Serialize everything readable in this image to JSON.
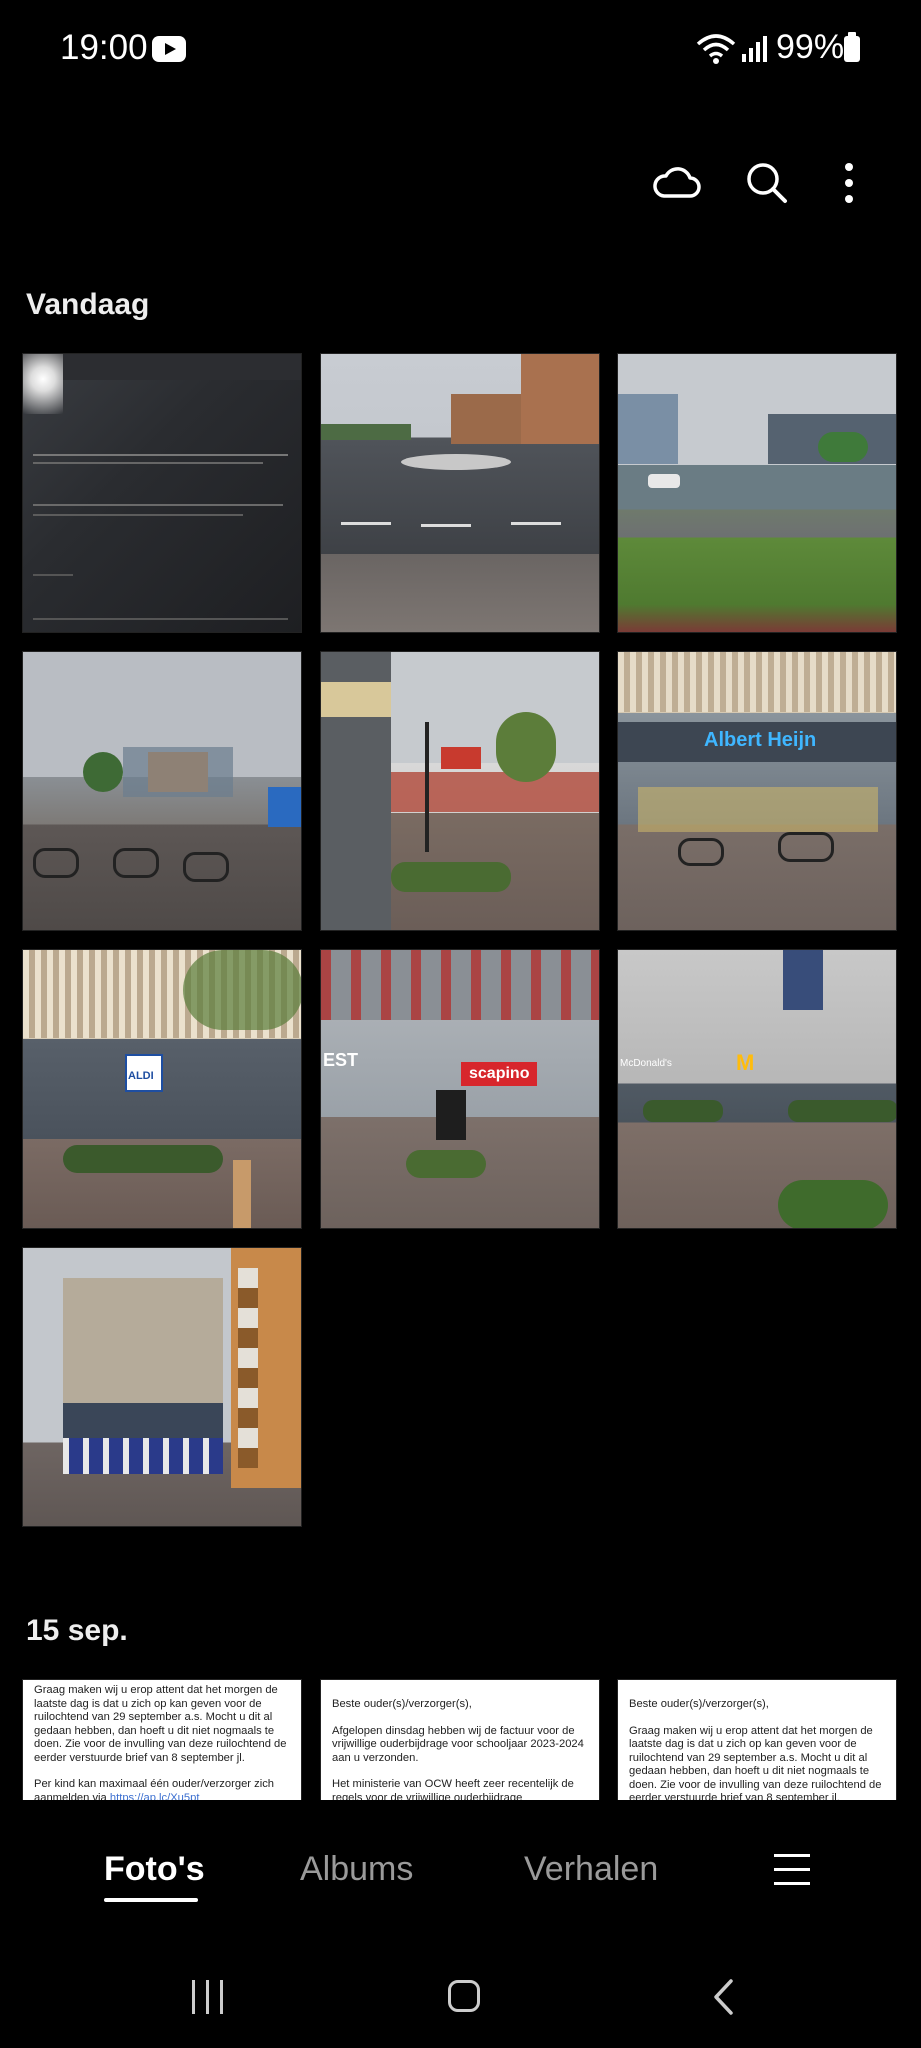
{
  "status_bar": {
    "time": "19:00",
    "battery": "99%"
  },
  "toolbar": {
    "icons": [
      "cloud-icon",
      "search-icon",
      "more-options-icon"
    ]
  },
  "sections": [
    {
      "title": "Vandaag",
      "photo_count": 10
    },
    {
      "title": "15 sep.",
      "docs": [
        {
          "para1": "Graag maken wij u erop attent dat het morgen de laatste dag is dat u zich op kan geven voor de ruilochtend van 29 september a.s. Mocht u dit al gedaan hebben, dan hoeft u dit niet nogmaals te doen. Zie voor de invulling van deze ruilochtend de eerder verstuurde brief van 8 september jl.",
          "para2": "Per kind kan maximaal één ouder/verzorger zich aanmelden via",
          "link": "https://ap.lc/Xu5pt"
        },
        {
          "para1": "Beste ouder(s)/verzorger(s),",
          "para2": "Afgelopen dinsdag hebben wij de factuur voor de vrijwillige ouderbijdrage voor schooljaar 2023-2024 aan u verzonden.",
          "para3": "Het ministerie van OCW heeft zeer recentelijk de regels voor de vrijwillige ouderbijdrage"
        },
        {
          "para1": "Beste ouder(s)/verzorger(s),",
          "para2": "Graag maken wij u erop attent dat het morgen de laatste dag is dat u zich op kan geven voor de ruilochtend van 29 september a.s. Mocht u dit al gedaan hebben, dan hoeft u dit niet nogmaals te doen. Zie voor de invulling van deze ruilochtend de eerder verstuurde brief van 8 september jl."
        }
      ]
    }
  ],
  "photo_texts": {
    "albert_heijn": "Albert Heijn",
    "aldi": "ALDI",
    "scapino": "scapino",
    "mcdonalds": "McDonald's",
    "est": "EST"
  },
  "tabs": [
    {
      "label": "Foto's",
      "active": true
    },
    {
      "label": "Albums",
      "active": false
    },
    {
      "label": "Verhalen",
      "active": false
    }
  ],
  "colors": {
    "background": "#000000",
    "accent": "#ffffff",
    "inactive_tab": "#9a9a9a"
  }
}
